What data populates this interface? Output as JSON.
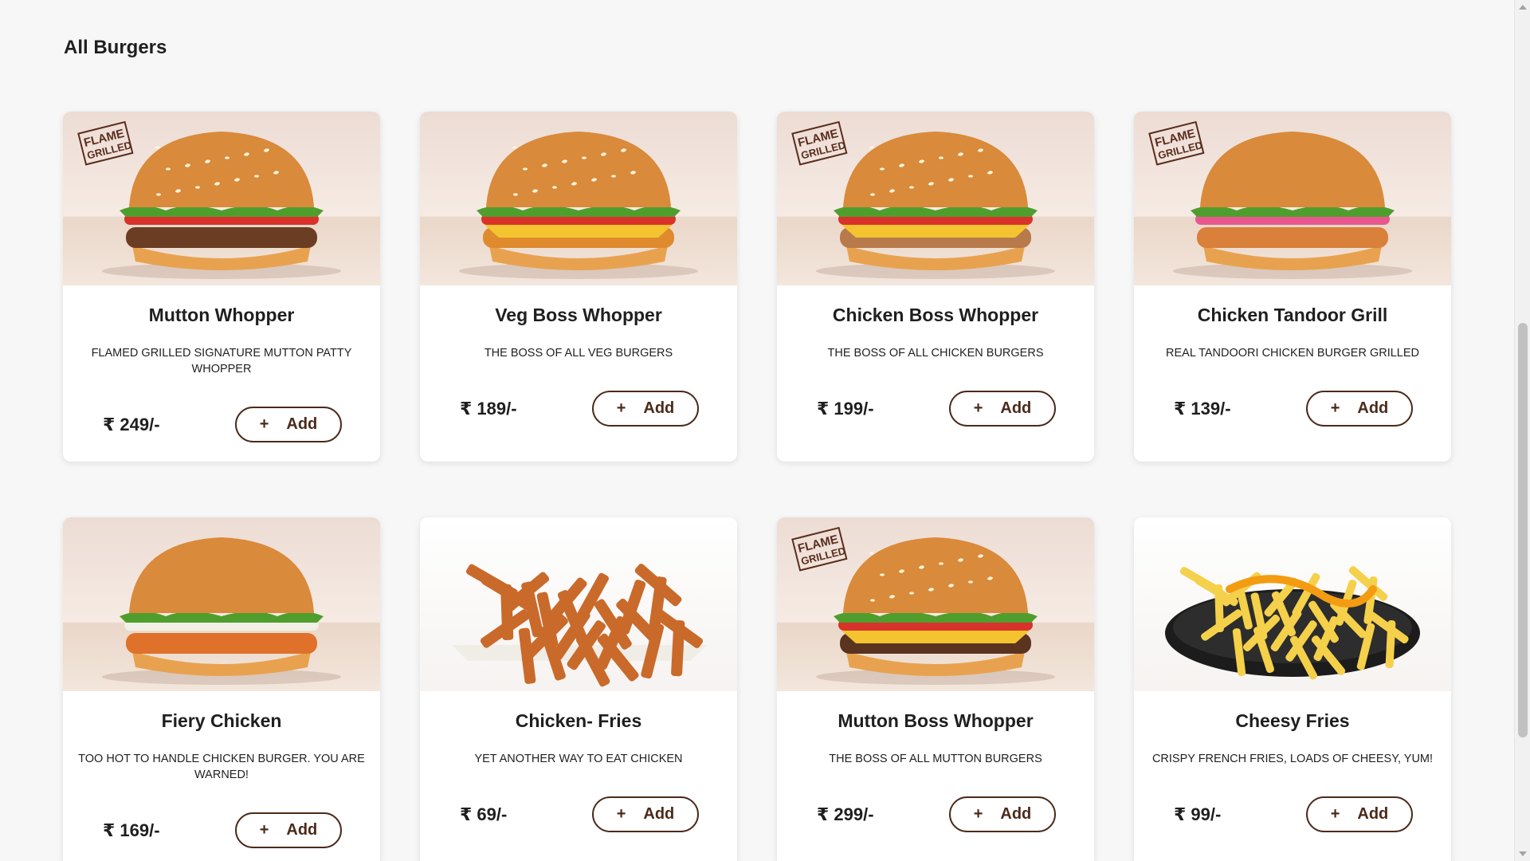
{
  "section": {
    "title": "All Burgers"
  },
  "currency_symbol": "₹",
  "products": [
    {
      "name": "Mutton Whopper",
      "description": "FLAMED GRILLED SIGNATURE MUTTON PATTY WHOPPER",
      "price": "₹ 249/-",
      "add_label": "Add",
      "flame_badge": "FLAME GRILLED",
      "image": "burger-mutton-icon"
    },
    {
      "name": "Veg Boss Whopper",
      "description": "THE BOSS OF ALL VEG BURGERS",
      "price": "₹ 189/-",
      "add_label": "Add",
      "flame_badge": "",
      "image": "burger-veg-icon"
    },
    {
      "name": "Chicken Boss Whopper",
      "description": "THE BOSS OF ALL CHICKEN BURGERS",
      "price": "₹ 199/-",
      "add_label": "Add",
      "flame_badge": "FLAME GRILLED",
      "image": "burger-chicken-icon"
    },
    {
      "name": "Chicken Tandoor Grill",
      "description": "REAL TANDOORI CHICKEN BURGER GRILLED",
      "price": "₹ 139/-",
      "add_label": "Add",
      "flame_badge": "FLAME GRILLED",
      "image": "burger-tandoor-icon"
    },
    {
      "name": "Fiery Chicken",
      "description": "TOO HOT TO HANDLE CHICKEN BURGER. YOU ARE WARNED!",
      "price": "₹ 169/-",
      "add_label": "Add",
      "flame_badge": "",
      "image": "burger-fiery-icon"
    },
    {
      "name": "Chicken- Fries",
      "description": "YET ANOTHER WAY TO EAT CHICKEN",
      "price": "₹ 69/-",
      "add_label": "Add",
      "flame_badge": "",
      "image": "chicken-fries-icon"
    },
    {
      "name": "Mutton Boss Whopper",
      "description": "THE BOSS OF ALL MUTTON BURGERS",
      "price": "₹ 299/-",
      "add_label": "Add",
      "flame_badge": "FLAME GRILLED",
      "image": "burger-mutton-boss-icon"
    },
    {
      "name": "Cheesy Fries",
      "description": "CRISPY FRENCH FRIES, LOADS OF CHEESY, YUM!",
      "price": "₹ 99/-",
      "add_label": "Add",
      "flame_badge": "",
      "image": "cheesy-fries-icon"
    }
  ],
  "colors": {
    "accent": "#4b2a1a",
    "card_bg": "#ffffff",
    "page_bg": "#f7f7f7"
  }
}
